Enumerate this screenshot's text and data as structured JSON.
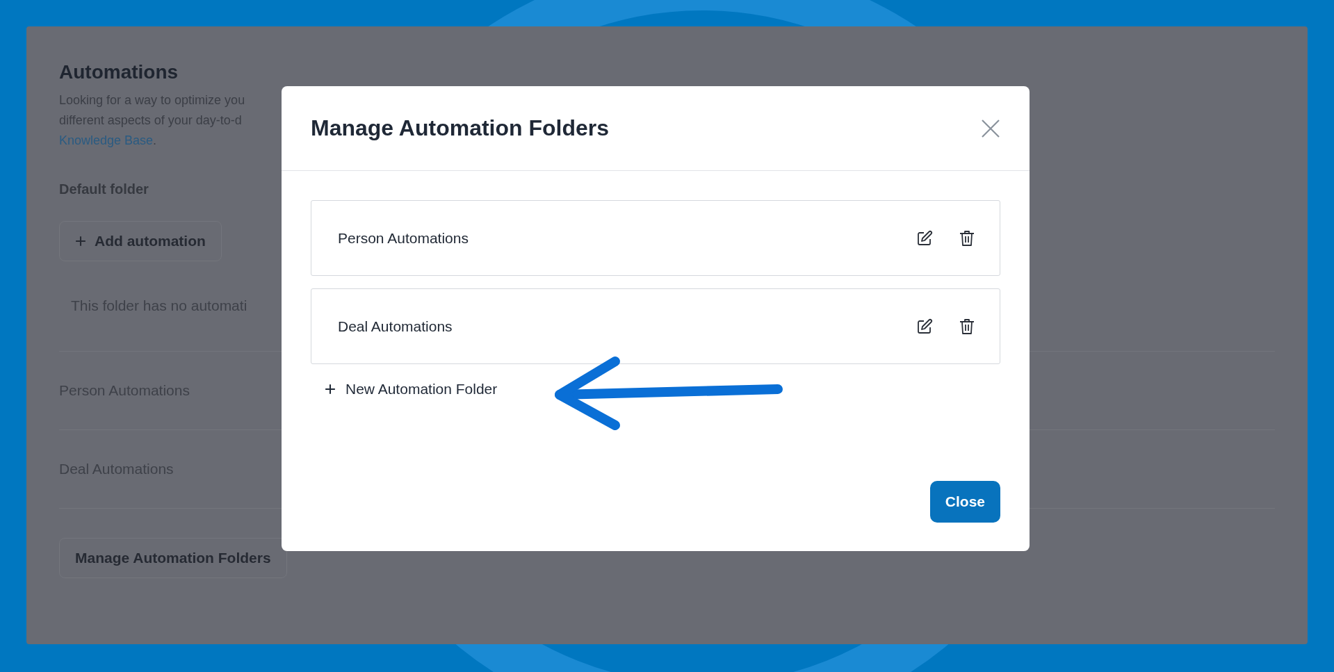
{
  "page": {
    "title": "Automations",
    "description": [
      "Looking for a way to optimize you",
      "different aspects of your day-to-d"
    ],
    "link": "Knowledge Base",
    "link_end": ".",
    "default_folder": {
      "title": "Default folder",
      "add_button": "Add automation",
      "empty_text": "This folder has no automati"
    },
    "folders": [
      {
        "name": "Person Automations"
      },
      {
        "name": "Deal Automations"
      }
    ],
    "manage_button": "Manage Automation Folders"
  },
  "modal": {
    "title": "Manage Automation Folders",
    "folders": [
      {
        "name": "Person Automations"
      },
      {
        "name": "Deal Automations"
      }
    ],
    "new_folder": "New Automation Folder",
    "close_button": "Close"
  }
}
